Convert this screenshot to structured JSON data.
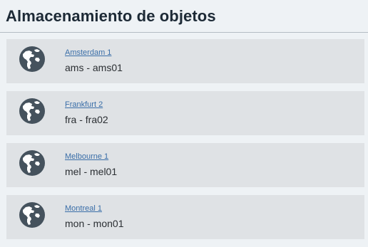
{
  "page": {
    "title": "Almacenamiento de objetos"
  },
  "regions": [
    {
      "name": "Amsterdam 1",
      "code": "ams - ams01",
      "icon": "globe-icon"
    },
    {
      "name": "Frankfurt 2",
      "code": "fra - fra02",
      "icon": "globe-icon"
    },
    {
      "name": "Melbourne 1",
      "code": "mel - mel01",
      "icon": "globe-icon"
    },
    {
      "name": "Montreal 1",
      "code": "mon - mon01",
      "icon": "globe-icon"
    }
  ],
  "colors": {
    "background": "#eef2f5",
    "card": "#dfe2e5",
    "globe": "#45525d",
    "link": "#3a6ea8",
    "title": "#1d2a36"
  }
}
